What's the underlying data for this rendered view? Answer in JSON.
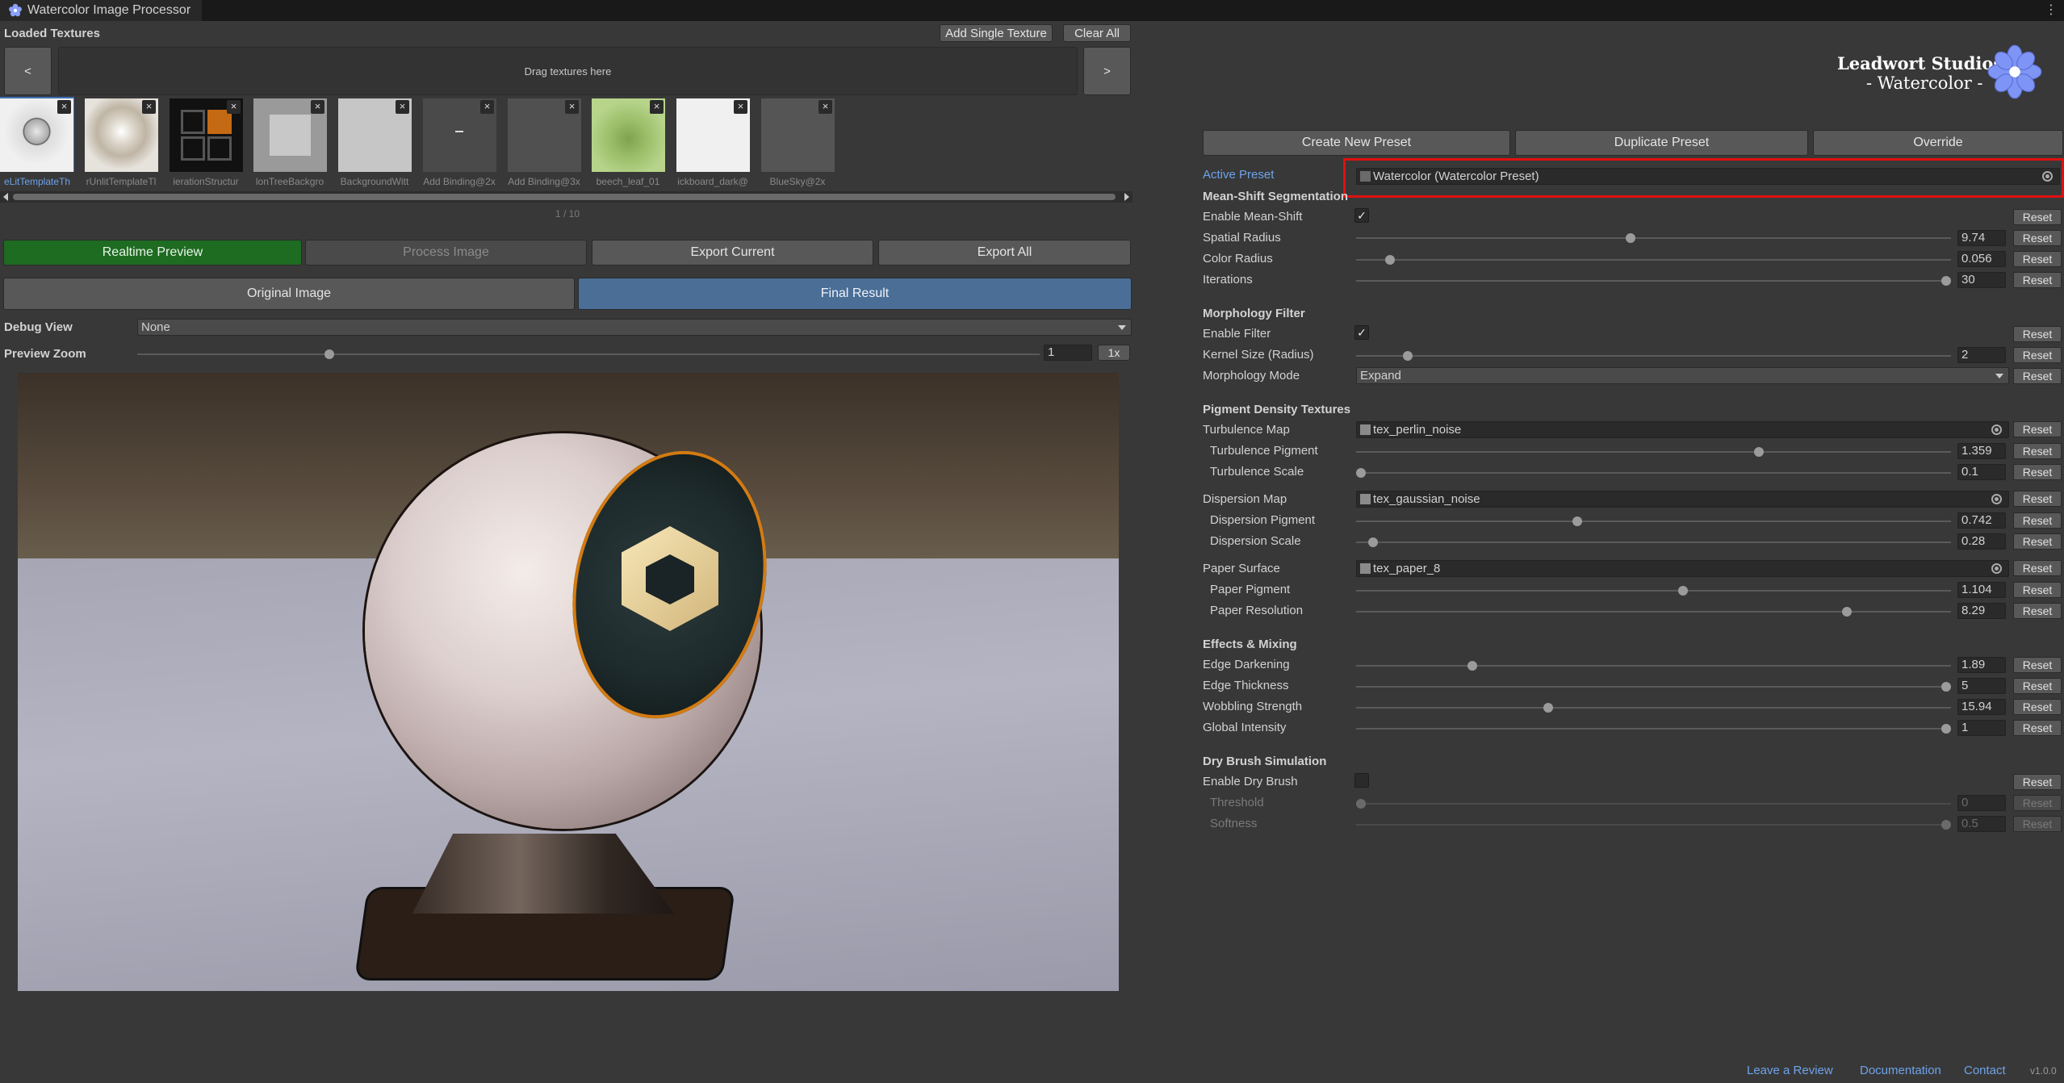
{
  "window": {
    "title": "Watercolor Image Processor",
    "menu_glyph": "⋮"
  },
  "loaded_textures": {
    "heading": "Loaded Textures",
    "add_single_label": "Add Single Texture",
    "clear_all_label": "Clear All",
    "prev_label": "<",
    "next_label": ">",
    "drop_hint": "Drag textures here",
    "thumbnails": [
      {
        "label": "eLitTemplateTh",
        "selected": true
      },
      {
        "label": "rUnlitTemplateTl",
        "selected": false
      },
      {
        "label": "ierationStructur",
        "selected": false
      },
      {
        "label": "lonTreeBackgro",
        "selected": false
      },
      {
        "label": "BackgroundWitt",
        "selected": false
      },
      {
        "label": "Add Binding@2x",
        "selected": false
      },
      {
        "label": "Add Binding@3x",
        "selected": false
      },
      {
        "label": "beech_leaf_01",
        "selected": false
      },
      {
        "label": "ickboard_dark@",
        "selected": false
      },
      {
        "label": "BlueSky@2x",
        "selected": false
      }
    ],
    "remove_glyph": "×",
    "pager": "1 / 10"
  },
  "actions": {
    "realtime_preview": "Realtime Preview",
    "process_image": "Process Image",
    "export_current": "Export Current",
    "export_all": "Export All",
    "original_image": "Original Image",
    "final_result": "Final Result"
  },
  "view": {
    "debug_label": "Debug View",
    "debug_value": "None",
    "zoom_label": "Preview Zoom",
    "zoom_value": "1",
    "zoom_fraction": 0.21,
    "zoom_reset": "1x"
  },
  "branding": {
    "line1": "Leadwort Studios",
    "line2": "- Watercolor -"
  },
  "presets": {
    "create": "Create New Preset",
    "duplicate": "Duplicate Preset",
    "override": "Override",
    "active_label": "Active Preset",
    "active_value": "Watercolor (Watercolor Preset)"
  },
  "reset_label": "Reset",
  "sections": {
    "mean_shift": "Mean-Shift Segmentation",
    "morphology": "Morphology Filter",
    "pigment": "Pigment Density Textures",
    "effects": "Effects & Mixing",
    "dry_brush": "Dry Brush Simulation"
  },
  "params": {
    "enable_mean_shift": {
      "label": "Enable Mean-Shift",
      "checked": true
    },
    "spatial_radius": {
      "label": "Spatial Radius",
      "value": "9.74",
      "fraction": 0.46
    },
    "color_radius": {
      "label": "Color Radius",
      "value": "0.056",
      "fraction": 0.05
    },
    "iterations": {
      "label": "Iterations",
      "value": "30",
      "fraction": 1.0
    },
    "enable_filter": {
      "label": "Enable Filter",
      "checked": true
    },
    "kernel_size": {
      "label": "Kernel Size (Radius)",
      "value": "2",
      "fraction": 0.08
    },
    "morphology_mode": {
      "label": "Morphology Mode",
      "value": "Expand"
    },
    "turbulence_map": {
      "label": "Turbulence Map",
      "value": "tex_perlin_noise"
    },
    "turbulence_pigment": {
      "label": "Turbulence Pigment",
      "value": "1.359",
      "fraction": 0.68
    },
    "turbulence_scale": {
      "label": "Turbulence Scale",
      "value": "0.1",
      "fraction": 0.0
    },
    "dispersion_map": {
      "label": "Dispersion Map",
      "value": "tex_gaussian_noise"
    },
    "dispersion_pigment": {
      "label": "Dispersion Pigment",
      "value": "0.742",
      "fraction": 0.37
    },
    "dispersion_scale": {
      "label": "Dispersion Scale",
      "value": "0.28",
      "fraction": 0.02
    },
    "paper_surface": {
      "label": "Paper Surface",
      "value": "tex_paper_8"
    },
    "paper_pigment": {
      "label": "Paper Pigment",
      "value": "1.104",
      "fraction": 0.55
    },
    "paper_resolution": {
      "label": "Paper Resolution",
      "value": "8.29",
      "fraction": 0.83
    },
    "edge_darkening": {
      "label": "Edge Darkening",
      "value": "1.89",
      "fraction": 0.19
    },
    "edge_thickness": {
      "label": "Edge Thickness",
      "value": "5",
      "fraction": 1.0
    },
    "wobbling_strength": {
      "label": "Wobbling Strength",
      "value": "15.94",
      "fraction": 0.32
    },
    "global_intensity": {
      "label": "Global Intensity",
      "value": "1",
      "fraction": 1.0
    },
    "enable_dry_brush": {
      "label": "Enable Dry Brush",
      "checked": false
    },
    "threshold": {
      "label": "Threshold",
      "value": "0",
      "fraction": 0.0
    },
    "softness": {
      "label": "Softness",
      "value": "0.5",
      "fraction": 1.0
    }
  },
  "footer": {
    "review": "Leave a Review",
    "docs": "Documentation",
    "contact": "Contact",
    "version": "v1.0.0"
  },
  "colors": {
    "accent_blue": "#6ea3ea",
    "realtime_green": "#1e6b22",
    "final_result_blue": "#4a6e96",
    "highlight_red": "#e01010"
  }
}
